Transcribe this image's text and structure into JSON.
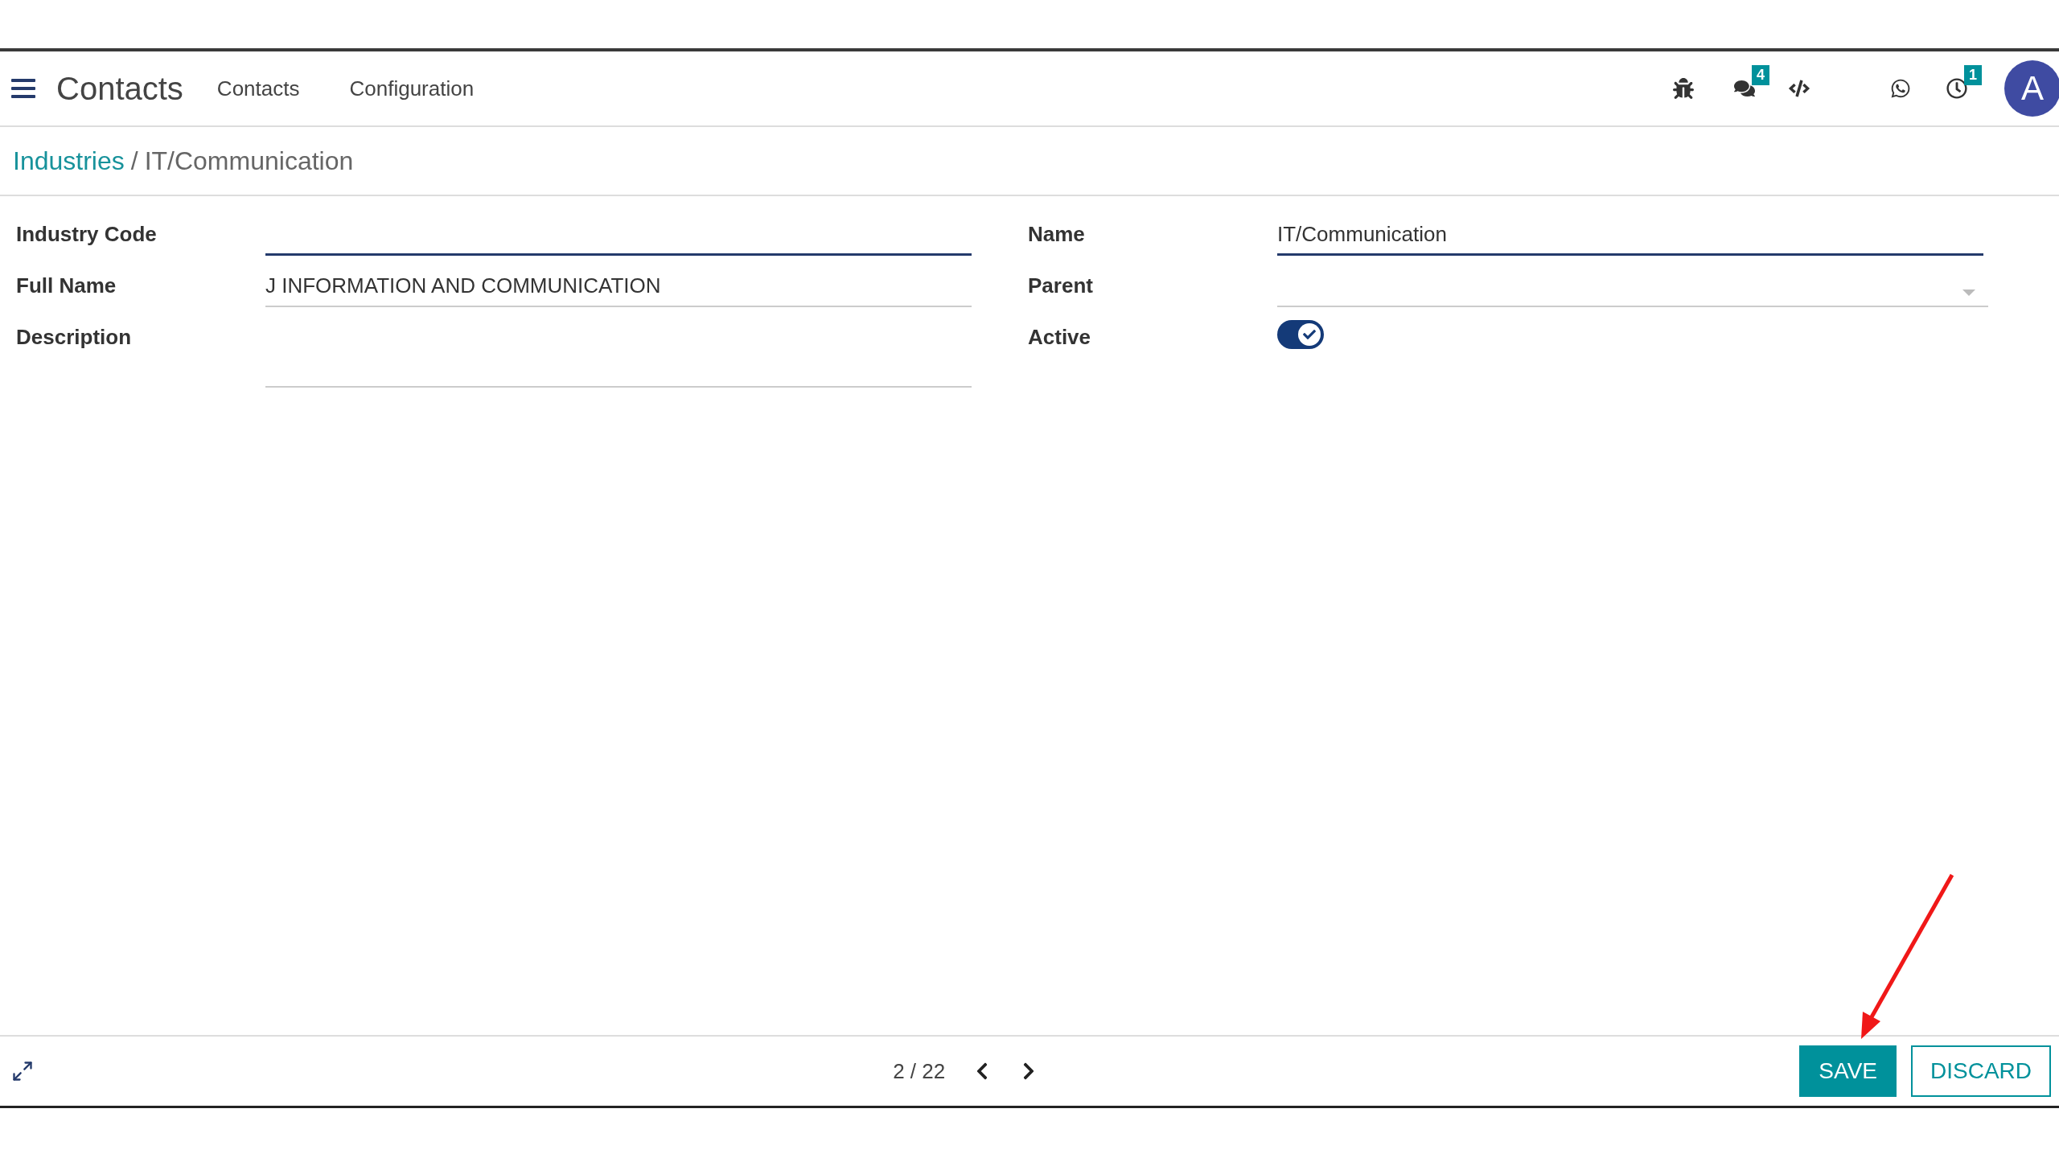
{
  "navbar": {
    "app_title": "Contacts",
    "menu": [
      "Contacts",
      "Configuration"
    ],
    "systray": [
      {
        "kind": "bug"
      },
      {
        "kind": "chat",
        "badge": "4"
      },
      {
        "kind": "code"
      },
      {
        "kind": "whatsapp"
      },
      {
        "kind": "clock",
        "badge": "1"
      }
    ],
    "avatar": "A"
  },
  "breadcrumb": {
    "parent": "Industries",
    "separator": "/",
    "current": "IT/Communication"
  },
  "form": {
    "left": [
      {
        "kind": "text",
        "label": "Industry Code",
        "focused": true
      },
      {
        "kind": "text",
        "label": "Full Name",
        "value": "J INFORMATION AND COMMUNICATION",
        "focused": false
      },
      {
        "kind": "textarea",
        "label": "Description",
        "focused": false
      }
    ],
    "right": [
      {
        "kind": "text",
        "label": "Name",
        "value": "IT/Communication",
        "focused": true
      },
      {
        "kind": "select",
        "label": "Parent",
        "focused": false
      },
      {
        "kind": "toggle",
        "label": "Active",
        "on": true
      }
    ]
  },
  "footer": {
    "pager": "2 / 22",
    "buttons": [
      {
        "label": "SAVE",
        "primary": true
      },
      {
        "label": "DISCARD",
        "primary": false
      }
    ]
  }
}
